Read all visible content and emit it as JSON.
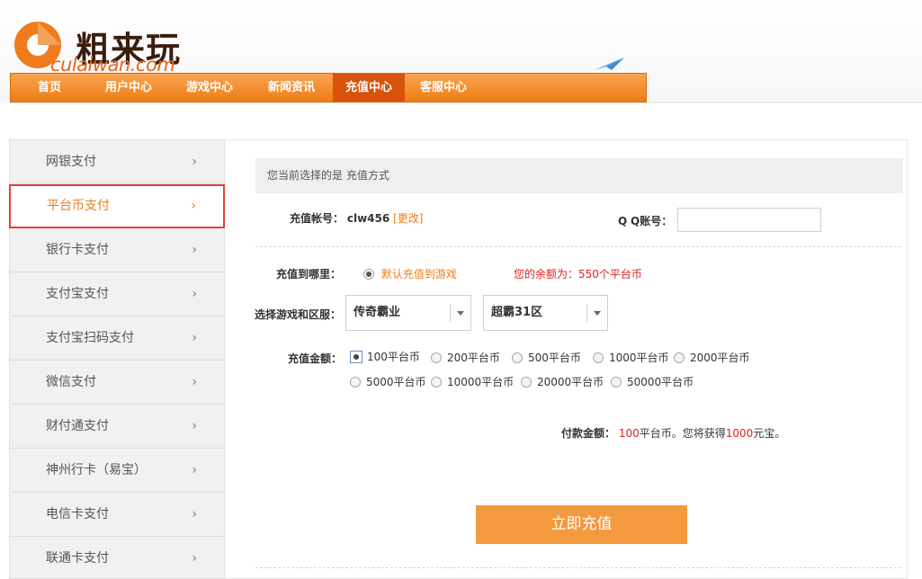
{
  "logo": {
    "cn": "粗来玩",
    "en": "culaiwan.com"
  },
  "nav": {
    "items": [
      {
        "label": "首页",
        "active": false
      },
      {
        "label": "用户中心",
        "active": false
      },
      {
        "label": "游戏中心",
        "active": false
      },
      {
        "label": "新闻资讯",
        "active": false
      },
      {
        "label": "充值中心",
        "active": true
      },
      {
        "label": "客服中心",
        "active": false
      }
    ]
  },
  "sidebar": {
    "items": [
      {
        "label": "网银支付"
      },
      {
        "label": "平台币支付"
      },
      {
        "label": "银行卡支付"
      },
      {
        "label": "支付宝支付"
      },
      {
        "label": "支付宝扫码支付"
      },
      {
        "label": "微信支付"
      },
      {
        "label": "财付通支付"
      },
      {
        "label": "神州行卡（易宝）"
      },
      {
        "label": "电信卡支付"
      },
      {
        "label": "联通卡支付"
      }
    ],
    "active_index": 1,
    "arrow": "›"
  },
  "main": {
    "info_bar": "您当前选择的是 充值方式",
    "account": {
      "label": "充值帐号：",
      "value": "clw456",
      "edit": "[更改]"
    },
    "qq": {
      "prefix": "Q",
      "label": "Q账号：",
      "value": ""
    },
    "target": {
      "label": "充值到哪里：",
      "option": "默认充值到游戏",
      "balance": "您的余额为：550个平台币"
    },
    "game": {
      "label": "选择游戏和区服：",
      "game_value": "传奇霸业",
      "server_value": "超霸31区"
    },
    "amount": {
      "label": "充值金额：",
      "options": [
        "100平台币",
        "200平台币",
        "500平台币",
        "1000平台币",
        "2000平台币",
        "5000平台币",
        "10000平台币",
        "20000平台币",
        "50000平台币"
      ],
      "selected_index": 0
    },
    "pay": {
      "label": "付款金额：",
      "amount": "100",
      "unit": "平台币。您将获得",
      "gain": "1000",
      "gain_unit": "元宝。"
    },
    "submit_label": "立即充值"
  },
  "colors": {
    "brand_orange": "#ee7d17",
    "nav_active": "#d9520b",
    "active_border": "#e3403a",
    "button": "#f39a3e"
  }
}
